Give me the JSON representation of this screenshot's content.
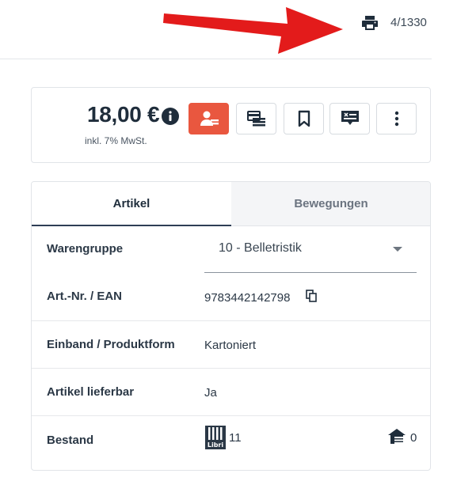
{
  "header": {
    "counter": "4/1330",
    "icons": {
      "arrow": "red-arrow-icon",
      "print": "printer-icon"
    },
    "colors": {
      "arrow": "#e31b1b"
    }
  },
  "price_card": {
    "price": "18,00 €",
    "vat_note": "inkl. 7% MwSt.",
    "actions": [
      {
        "icon": "customer-order-icon",
        "primary": true
      },
      {
        "icon": "cash-register-icon"
      },
      {
        "icon": "bookmark-icon"
      },
      {
        "icon": "book-list-icon"
      },
      {
        "icon": "more-vertical-icon"
      }
    ],
    "colors": {
      "primary_action": "#e9573f"
    }
  },
  "tabs": [
    {
      "label": "Artikel",
      "active": true
    },
    {
      "label": "Bewegungen",
      "active": false
    }
  ],
  "details": {
    "warengruppe": {
      "label": "Warengruppe",
      "value": "10 - Belletristik"
    },
    "ean": {
      "label": "Art.-Nr. / EAN",
      "value": "9783442142798"
    },
    "einband": {
      "label": "Einband / Produktform",
      "value": "Kartoniert"
    },
    "lieferbar": {
      "label": "Artikel lieferbar",
      "value": "Ja"
    },
    "bestand": {
      "label": "Bestand",
      "libri_value": "11",
      "libri_logo_text": "Libri",
      "store_value": "0"
    }
  }
}
